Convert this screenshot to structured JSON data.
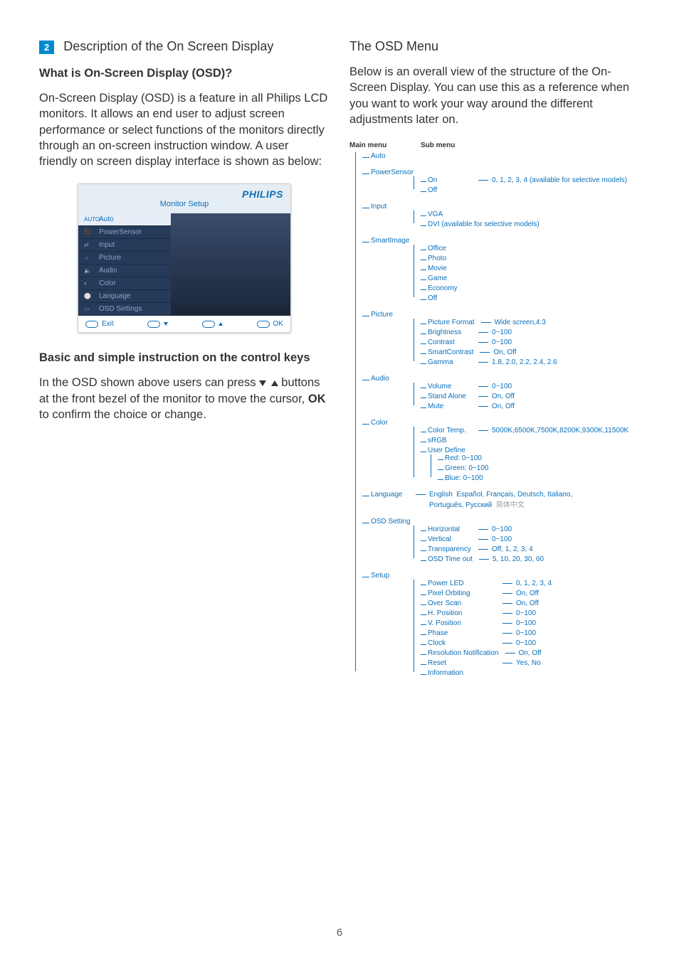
{
  "section_number": "2",
  "section_title": "Description of the On Screen Display",
  "left": {
    "h_what": "What is On-Screen Display (OSD)?",
    "p1": "On-Screen Display (OSD) is a feature in all Philips LCD monitors. It allows an end user to adjust screen performance or select functions of the monitors directly through an on-screen instruction window. A user friendly on screen display interface is shown as below:",
    "h_basic": "Basic and simple instruction on the control keys",
    "p2a": "In the OSD shown above users can press ",
    "p2b": " buttons at the front bezel of the monitor to move the cursor, ",
    "ok": "OK",
    "p2c": " to confirm the choice or change."
  },
  "right": {
    "h_menu": "The OSD Menu",
    "p1": "Below is an overall view of the structure of the On-Screen Display. You can use this as a reference when you want to work your way around the different adjustments later on."
  },
  "osd_figure": {
    "brand": "PHILIPS",
    "title": "Monitor Setup",
    "items": [
      "Auto",
      "PowerSensor",
      "Input",
      "Picture",
      "Audio",
      "Color",
      "Language",
      "OSD Settings"
    ],
    "icons": [
      "AUTO",
      "⬛",
      "⇄",
      "☼",
      "🔈",
      "◐",
      "⚪",
      "▭"
    ],
    "exit": "Exit",
    "ok": "OK"
  },
  "tree": {
    "head_main": "Main menu",
    "head_sub": "Sub menu",
    "main": [
      {
        "label": "Auto"
      },
      {
        "label": "PowerSensor",
        "sub": [
          {
            "label": "On",
            "val": "0, 1, 2, 3, 4 (available for selective models)"
          },
          {
            "label": "Off"
          }
        ]
      },
      {
        "label": "Input",
        "sub": [
          {
            "label": "VGA"
          },
          {
            "label": "DVI (available for selective models)"
          }
        ]
      },
      {
        "label": "SmartImage",
        "sub": [
          {
            "label": "Office"
          },
          {
            "label": "Photo"
          },
          {
            "label": "Movie"
          },
          {
            "label": "Game"
          },
          {
            "label": "Economy"
          },
          {
            "label": "Off"
          }
        ]
      },
      {
        "label": "Picture",
        "sub": [
          {
            "label": "Picture Format",
            "val": "Wide screen,4:3"
          },
          {
            "label": "Brightness",
            "val": "0~100"
          },
          {
            "label": "Contrast",
            "val": "0~100"
          },
          {
            "label": "SmartContrast",
            "val": "On, Off"
          },
          {
            "label": "Gamma",
            "val": "1.8, 2.0, 2.2, 2.4, 2.6"
          }
        ]
      },
      {
        "label": "Audio",
        "sub": [
          {
            "label": "Volume",
            "val": "0~100"
          },
          {
            "label": "Stand Alone",
            "val": "On, Off"
          },
          {
            "label": "Mute",
            "val": "On, Off"
          }
        ]
      },
      {
        "label": "Color",
        "sub": [
          {
            "label": "Color Temp.",
            "val": "5000K,6500K,7500K,8200K,9300K,11500K"
          },
          {
            "label": "sRGB"
          },
          {
            "label": "User Define",
            "sub": [
              {
                "label": "Red: 0~100"
              },
              {
                "label": "Green: 0~100"
              },
              {
                "label": "Blue: 0~100"
              }
            ]
          }
        ]
      },
      {
        "label": "Language",
        "val_inline": "English",
        "val_rest": "Español, Français, Deutsch, Italiano,",
        "val_line2": "Português, Русский",
        "val_grey": "简体中文"
      },
      {
        "label": "OSD Setting",
        "sub": [
          {
            "label": "Horizontal",
            "val": "0~100"
          },
          {
            "label": "Vertical",
            "val": "0~100"
          },
          {
            "label": "Transparency",
            "val": "Off, 1, 2, 3, 4"
          },
          {
            "label": "OSD Time out",
            "val": "5, 10, 20, 30, 60"
          }
        ]
      },
      {
        "label": "Setup",
        "sub": [
          {
            "label": "Power LED",
            "val": "0, 1, 2, 3, 4"
          },
          {
            "label": "Pixel Orbiting",
            "val": "On, Off"
          },
          {
            "label": "Over Scan",
            "val": "On, Off"
          },
          {
            "label": "H. Position",
            "val": "0~100"
          },
          {
            "label": "V. Position",
            "val": "0~100"
          },
          {
            "label": "Phase",
            "val": "0~100"
          },
          {
            "label": "Clock",
            "val": "0~100"
          },
          {
            "label": "Resolution Notification",
            "val": "On, Off"
          },
          {
            "label": "Reset",
            "val": "Yes, No"
          },
          {
            "label": "Information"
          }
        ]
      }
    ]
  },
  "page_number": "6"
}
